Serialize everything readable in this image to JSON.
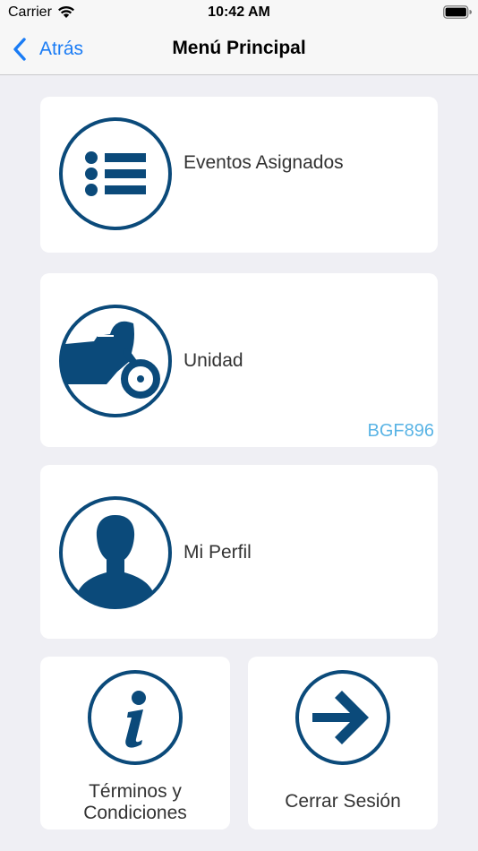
{
  "status_bar": {
    "carrier": "Carrier",
    "time": "10:42 AM"
  },
  "nav": {
    "back_label": "Atrás",
    "title": "Menú Principal"
  },
  "menu": {
    "events_label": "Eventos Asignados",
    "unit_label": "Unidad",
    "unit_plate": "BGF896",
    "profile_label": "Mi Perfil",
    "terms_label_line1": "Términos y",
    "terms_label_line2": "Condiciones",
    "logout_label": "Cerrar Sesión"
  },
  "colors": {
    "icon_blue": "#0b4a7a",
    "accent_blue": "#1a7cf5",
    "plate_blue": "#5ab4e5",
    "background": "#efeff4"
  },
  "icons": {
    "events": "list-icon",
    "unit": "motorcycle-icon",
    "profile": "user-silhouette-icon",
    "terms": "info-icon",
    "logout": "arrow-right-icon"
  }
}
